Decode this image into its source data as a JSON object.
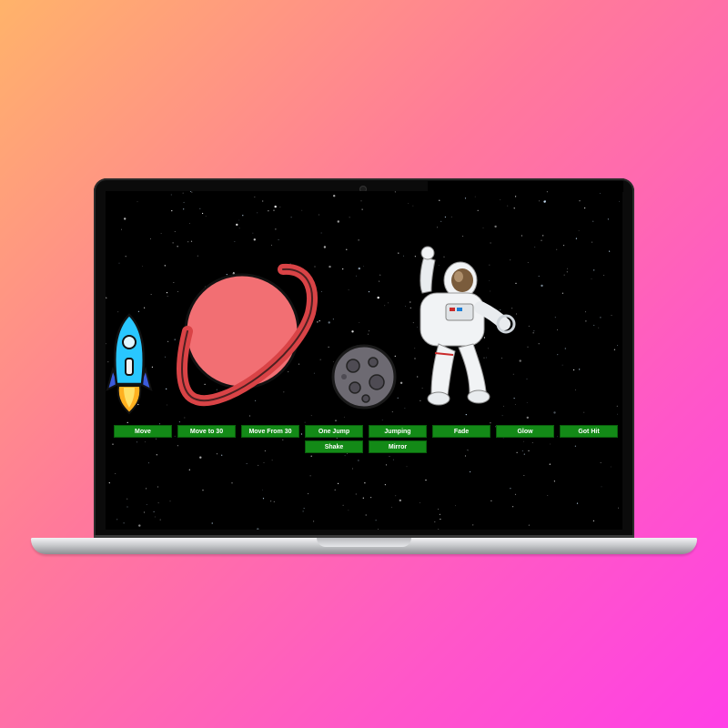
{
  "app": {
    "background_gradient": [
      "#ffb36a",
      "#ff7a9a",
      "#ff3fe6"
    ],
    "button_color": "#138a17"
  },
  "sprites": {
    "rocket": "rocket-icon",
    "planet": "ringed-planet-icon",
    "asteroid": "asteroid-icon",
    "astronaut": "astronaut-image"
  },
  "controls": {
    "buttons": [
      {
        "id": "move",
        "label": "Move"
      },
      {
        "id": "move-to-30",
        "label": "Move to 30"
      },
      {
        "id": "move-from-30",
        "label": "Move From 30"
      },
      {
        "id": "one-jump",
        "label": "One Jump"
      },
      {
        "id": "jumping",
        "label": "Jumping"
      },
      {
        "id": "fade",
        "label": "Fade"
      },
      {
        "id": "glow",
        "label": "Glow"
      },
      {
        "id": "got-hit",
        "label": "Got Hit"
      },
      {
        "id": "shake",
        "label": "Shake"
      },
      {
        "id": "mirror",
        "label": "Mirror"
      }
    ]
  }
}
